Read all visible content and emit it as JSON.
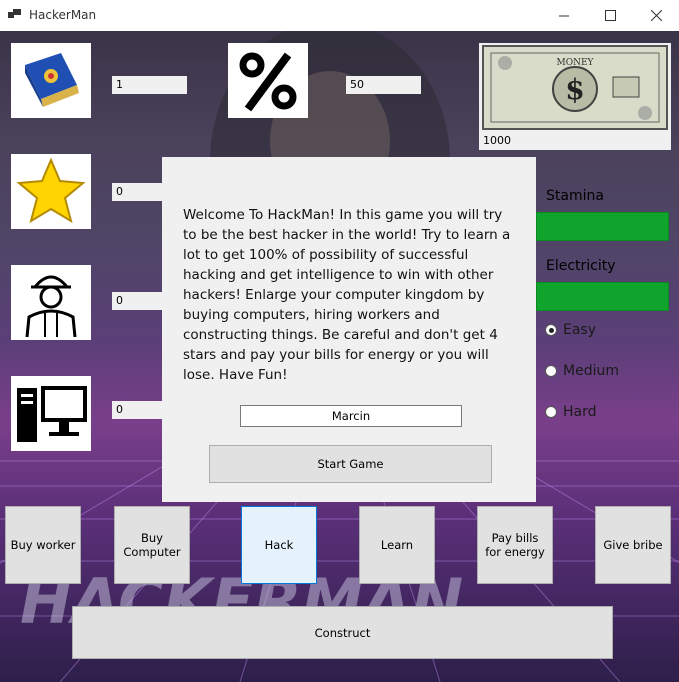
{
  "window": {
    "title": "HackerMan"
  },
  "stats": {
    "knowledge_value": "1",
    "percent_value": "50",
    "money_value": "1000",
    "stars_value": "0",
    "workers_value": "0",
    "computers_value": "0"
  },
  "labels": {
    "stamina": "Stamina",
    "electricity": "Electricity"
  },
  "difficulty": {
    "options": [
      "Easy",
      "Medium",
      "Hard"
    ],
    "selected": "Easy"
  },
  "buttons": {
    "buy_worker": "Buy worker",
    "buy_computer": "Buy Computer",
    "hack": "Hack",
    "learn": "Learn",
    "pay_bills": "Pay bills for energy",
    "give_bribe": "Give bribe",
    "construct": "Construct"
  },
  "dialog": {
    "message": "Welcome To HackMan! In this game you will try to be the best hacker in the world! Try to learn a lot to get 100% of possibility of successful hacking and get intelligence to win with other hackers! Enlarge your computer kingdom by buying computers, hiring workers and constructing things. Be careful and don't get 4 stars and pay your bills for energy or you will lose. Have Fun!",
    "name_value": "Marcin",
    "start_label": "Start Game"
  },
  "colors": {
    "bar_green": "#0fa52d",
    "focus_blue": "#0078d7"
  }
}
